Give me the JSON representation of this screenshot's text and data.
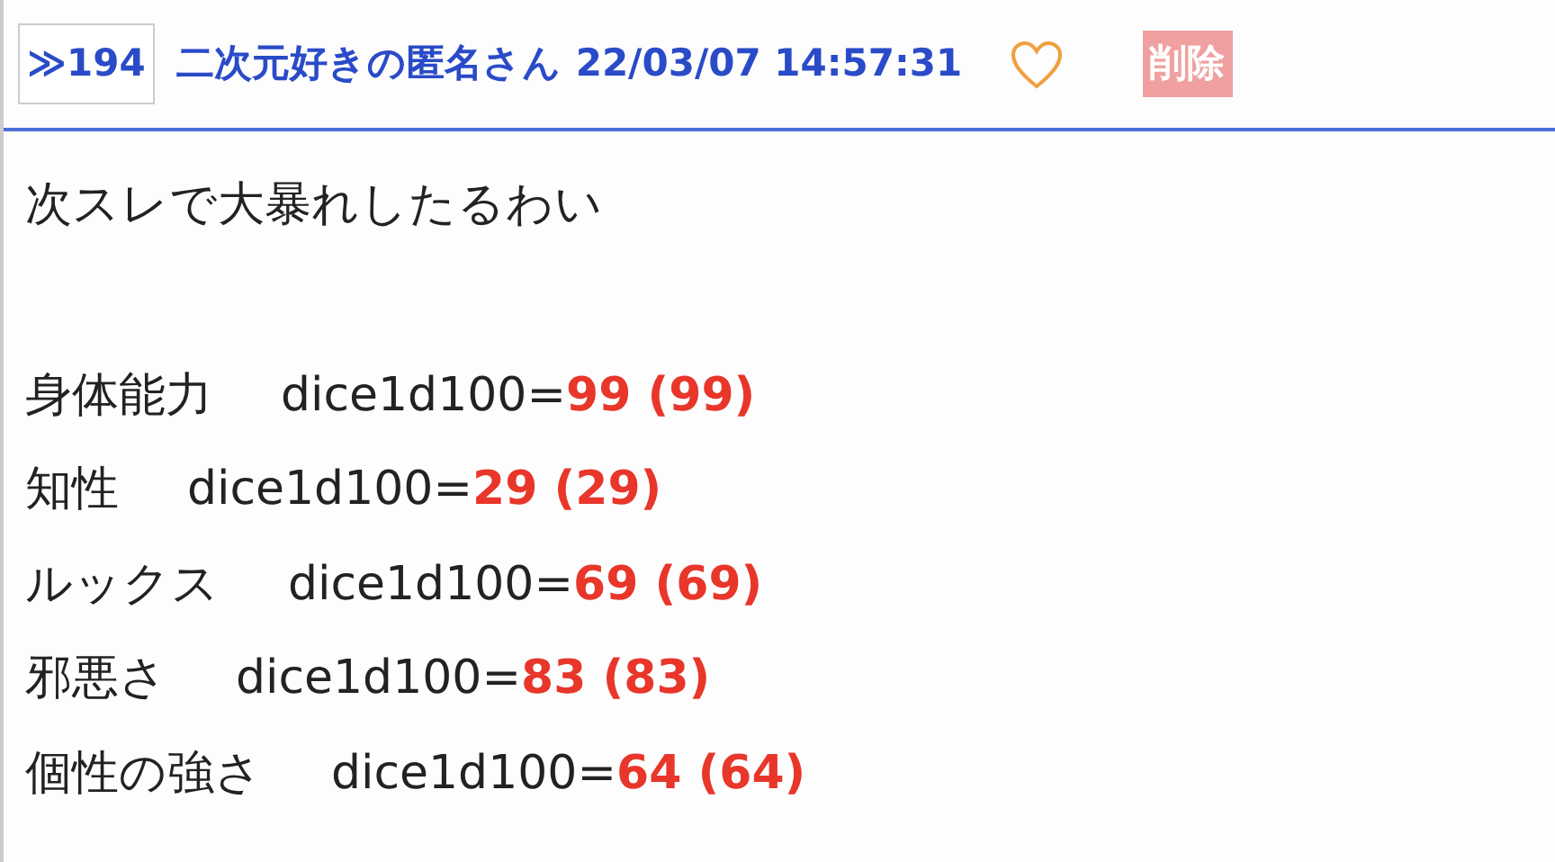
{
  "post": {
    "number": "≫194",
    "author": "二次元好きの匿名さん",
    "timestamp": "22/03/07 14:57:31",
    "liked": false,
    "delete_label": "削除"
  },
  "message": "次スレで大暴れしたるわい",
  "rolls": [
    {
      "label": "身体能力",
      "expression": "dice1d100=",
      "result": "99 (99)"
    },
    {
      "label": "知性",
      "expression": "dice1d100=",
      "result": "29 (29)"
    },
    {
      "label": "ルックス",
      "expression": "dice1d100=",
      "result": "69 (69)"
    },
    {
      "label": "邪悪さ",
      "expression": "dice1d100=",
      "result": "83 (83)"
    },
    {
      "label": "個性の強さ",
      "expression": "dice1d100=",
      "result": "64 (64)"
    }
  ]
}
